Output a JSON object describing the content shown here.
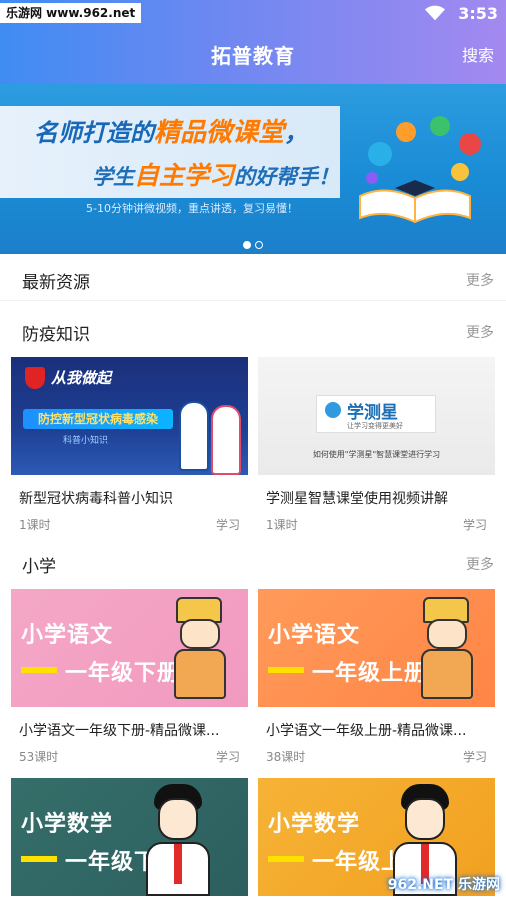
{
  "status_bar": {
    "watermark": "乐游网 www.962.net",
    "time": "3:53"
  },
  "header": {
    "title": "拓普教育",
    "search_label": "搜索"
  },
  "banner": {
    "line1_a": "名师打造的",
    "line1_b": "精品微课堂",
    "line1_c": "，",
    "line2_a": "学生",
    "line2_b": "自主学习",
    "line2_c": "的好帮手！",
    "line3": "5-10分钟讲微视频，重点讲透，复习易懂！",
    "dots": 2,
    "active_dot": 0
  },
  "sections": [
    {
      "title": "最新资源",
      "more": "更多"
    },
    {
      "title": "防疫知识",
      "more": "更多"
    },
    {
      "title": "小学",
      "more": "更多"
    }
  ],
  "fangyi_cards": [
    {
      "title": "新型冠状病毒科普小知识",
      "lessons": "1课时",
      "action": "学习",
      "thumb": {
        "head": "从我做起",
        "ribbon": "防控新型冠状病毒感染",
        "sub": "科普小知识"
      }
    },
    {
      "title": "学测星智慧课堂使用视频讲解",
      "lessons": "1课时",
      "action": "学习",
      "thumb": {
        "name": "学测星",
        "slogan": "让学习变得更美好",
        "caption": "如何使用\"学测星\"智慧课堂进行学习"
      }
    }
  ],
  "primary_cards": [
    {
      "title": "小学语文一年级下册-精品微课...",
      "lessons": "53课时",
      "action": "学习",
      "thumb": {
        "subject": "小学语文",
        "grade": "一年级下册"
      }
    },
    {
      "title": "小学语文一年级上册-精品微课...",
      "lessons": "38课时",
      "action": "学习",
      "thumb": {
        "subject": "小学语文",
        "grade": "一年级上册"
      }
    },
    {
      "thumb": {
        "subject": "小学数学",
        "grade": "一年级下册"
      }
    },
    {
      "thumb": {
        "subject": "小学数学",
        "grade": "一年级上册"
      }
    }
  ],
  "corner_watermark": "962.NET 乐游网",
  "colors": {
    "header_start": "#3f8cf2",
    "header_end": "#a389f0",
    "banner": "#1a8cd6",
    "accent_orange": "#ff7a00"
  }
}
